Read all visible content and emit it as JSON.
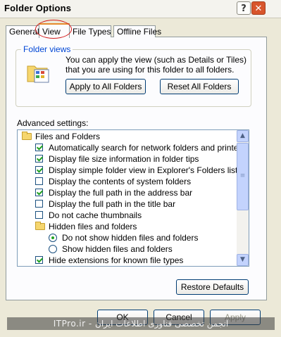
{
  "window": {
    "title": "Folder Options",
    "help_label": "?",
    "close_label": "✕"
  },
  "tabs": [
    {
      "label": "General"
    },
    {
      "label": "View"
    },
    {
      "label": "File Types"
    },
    {
      "label": "Offline Files"
    }
  ],
  "folder_views": {
    "group_label": "Folder views",
    "description": "You can apply the view (such as Details or Tiles) that you are using for this folder to all folders.",
    "apply_button": "Apply to All Folders",
    "reset_button": "Reset All Folders"
  },
  "advanced": {
    "label": "Advanced settings:",
    "items": [
      {
        "kind": "folder",
        "label": "Files and Folders"
      },
      {
        "kind": "check",
        "checked": true,
        "label": "Automatically search for network folders and printers"
      },
      {
        "kind": "check",
        "checked": true,
        "label": "Display file size information in folder tips"
      },
      {
        "kind": "check",
        "checked": true,
        "label": "Display simple folder view in Explorer's Folders list"
      },
      {
        "kind": "check",
        "checked": false,
        "label": "Display the contents of system folders"
      },
      {
        "kind": "check",
        "checked": true,
        "label": "Display the full path in the address bar"
      },
      {
        "kind": "check",
        "checked": false,
        "label": "Display the full path in the title bar"
      },
      {
        "kind": "check",
        "checked": false,
        "label": "Do not cache thumbnails"
      },
      {
        "kind": "folder",
        "label": "Hidden files and folders"
      },
      {
        "kind": "radio",
        "checked": true,
        "label": "Do not show hidden files and folders"
      },
      {
        "kind": "radio",
        "checked": false,
        "label": "Show hidden files and folders"
      },
      {
        "kind": "check",
        "checked": true,
        "label": "Hide extensions for known file types"
      }
    ],
    "restore_button": "Restore Defaults"
  },
  "footer": {
    "ok_button": "OK",
    "cancel_button": "Cancel",
    "apply_button": "Apply",
    "watermark": "ITPro.ir - انجمن تخصصی فناوری اطلاعات ایران"
  },
  "colors": {
    "accent_tab": "#e68b2c",
    "group_label": "#0046d5",
    "annotation_circle": "#d21a1a",
    "check_mark": "#21a121"
  }
}
